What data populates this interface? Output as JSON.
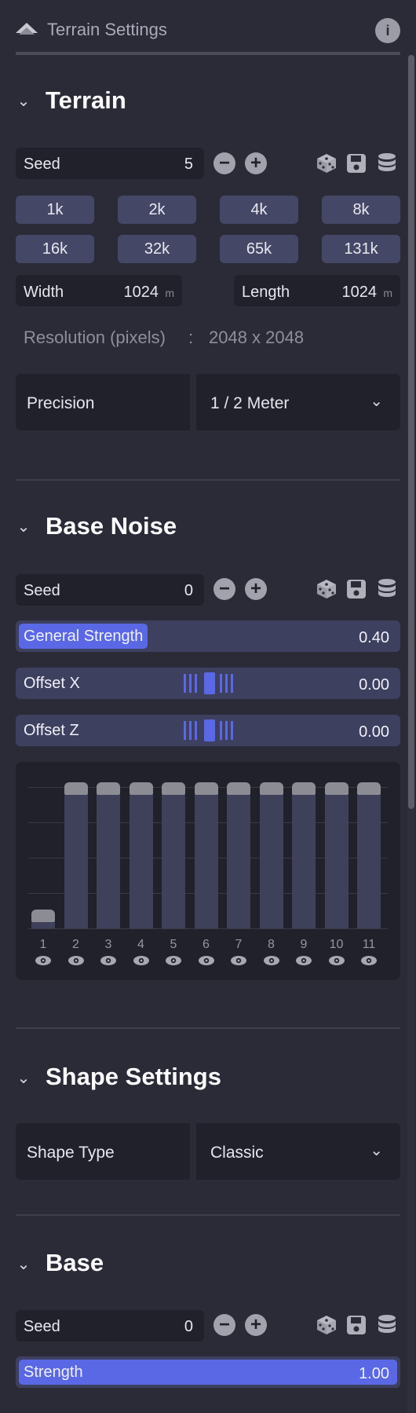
{
  "header": {
    "title": "Terrain Settings",
    "info_icon": "info-icon"
  },
  "terrain": {
    "title": "Terrain",
    "seed": {
      "label": "Seed",
      "value": "5"
    },
    "sizes": [
      "1k",
      "2k",
      "4k",
      "8k",
      "16k",
      "32k",
      "65k",
      "131k"
    ],
    "width": {
      "label": "Width",
      "value": "1024",
      "unit": "m"
    },
    "length": {
      "label": "Length",
      "value": "1024",
      "unit": "m"
    },
    "resolution": {
      "label": "Resolution (pixels)",
      "separator": ":",
      "value": "2048 x 2048"
    },
    "precision": {
      "label": "Precision",
      "value": "1 / 2 Meter"
    }
  },
  "base_noise": {
    "title": "Base Noise",
    "seed": {
      "label": "Seed",
      "value": "0"
    },
    "general_strength": {
      "label": "General Strength",
      "value": "0.40",
      "fill_fraction": 0.34
    },
    "offset_x": {
      "label": "Offset X",
      "value": "0.00"
    },
    "offset_z": {
      "label": "Offset Z",
      "value": "0.00"
    },
    "octaves": [
      "1",
      "2",
      "3",
      "4",
      "5",
      "6",
      "7",
      "8",
      "9",
      "10",
      "11"
    ]
  },
  "chart_data": {
    "type": "bar",
    "categories": [
      "1",
      "2",
      "3",
      "4",
      "5",
      "6",
      "7",
      "8",
      "9",
      "10",
      "11"
    ],
    "values": [
      0.1,
      1,
      1,
      1,
      1,
      1,
      1,
      1,
      1,
      1,
      1
    ],
    "ylim": [
      0,
      1
    ],
    "grid": true
  },
  "shape_settings": {
    "title": "Shape Settings",
    "shape_type": {
      "label": "Shape Type",
      "value": "Classic"
    }
  },
  "base": {
    "title": "Base",
    "seed": {
      "label": "Seed",
      "value": "0"
    },
    "strength": {
      "label": "Strength",
      "value": "1.00",
      "fill_fraction": 1.0
    }
  },
  "colors": {
    "background": "#2b2b38",
    "panel": "#21212b",
    "button": "#454766",
    "accent": "#5a68e6"
  }
}
